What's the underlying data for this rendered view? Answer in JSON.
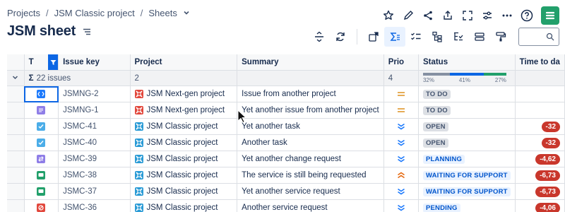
{
  "breadcrumb": {
    "items": [
      "Projects",
      "JSM Classic project",
      "Sheets"
    ]
  },
  "page": {
    "title": "JSM sheet"
  },
  "top_icons": [
    "star-icon",
    "edit-icon",
    "share-icon",
    "export-icon",
    "fullscreen-icon",
    "settings-sliders-icon",
    "more-icon",
    "help-icon",
    "app-logo"
  ],
  "toolbar": {
    "icons": [
      "row-height-icon",
      "refresh-icon",
      "add-view-icon",
      "sum-icon",
      "checklist-icon",
      "hierarchy-icon",
      "filter-tree-icon",
      "group-icon",
      "format-paint-icon"
    ],
    "search_placeholder": ""
  },
  "columns": [
    "T",
    "Issue key",
    "Project",
    "Summary",
    "Prio",
    "Status",
    "Time to da"
  ],
  "summary_row": {
    "issue_count": "22 issues",
    "project_count": "2",
    "prio_count": "4",
    "status_breakdown": [
      {
        "label": "32%",
        "color": "#8590a2",
        "fraction": 0.32
      },
      {
        "label": "41%",
        "color": "#0c66e4",
        "fraction": 0.41
      },
      {
        "label": "27%",
        "color": "#22a06b",
        "fraction": 0.27
      }
    ]
  },
  "rows": [
    {
      "type_color": "#1d7afc",
      "type_icon": "code-icon",
      "key": "JSMNG-2",
      "project": "JSM Next-gen project",
      "project_av": "#e2483d",
      "summary": "Issue from another project",
      "prio": "medium",
      "status": "TO DO",
      "status_class": "st-todo",
      "ttd": ""
    },
    {
      "type_color": "#8f7ee7",
      "type_icon": "list-icon",
      "key": "JSMNG-1",
      "project": "JSM Next-gen project",
      "project_av": "#e2483d",
      "summary": "Yet another issue from another project",
      "prio": "medium",
      "status": "TO DO",
      "status_class": "st-todo",
      "ttd": ""
    },
    {
      "type_color": "#4bade8",
      "type_icon": "check-icon",
      "key": "JSMC-41",
      "project": "JSM Classic project",
      "project_av": "#2a9bd6",
      "summary": "Yet another task",
      "prio": "low",
      "status": "OPEN",
      "status_class": "st-open",
      "ttd": "-32"
    },
    {
      "type_color": "#4bade8",
      "type_icon": "check-icon",
      "key": "JSMC-40",
      "project": "JSM Classic project",
      "project_av": "#2a9bd6",
      "summary": "Another task",
      "prio": "low",
      "status": "OPEN",
      "status_class": "st-open",
      "ttd": "-32"
    },
    {
      "type_color": "#8f7ee7",
      "type_icon": "change-icon",
      "key": "JSMC-39",
      "project": "JSM Classic project",
      "project_av": "#2a9bd6",
      "summary": "Yet another change request",
      "prio": "low",
      "status": "PLANNING",
      "status_class": "st-blue",
      "ttd": "-4,62"
    },
    {
      "type_color": "#22a06b",
      "type_icon": "chat-icon",
      "key": "JSMC-38",
      "project": "JSM Classic project",
      "project_av": "#2a9bd6",
      "summary": "The service is still being requested",
      "prio": "high",
      "status": "WAITING FOR SUPPORT",
      "status_class": "st-blue",
      "ttd": "-6,73"
    },
    {
      "type_color": "#22a06b",
      "type_icon": "chat-icon",
      "key": "JSMC-37",
      "project": "JSM Classic project",
      "project_av": "#2a9bd6",
      "summary": "Yet another service request",
      "prio": "low",
      "status": "WAITING FOR SUPPORT",
      "status_class": "st-blue",
      "ttd": "-6,73"
    },
    {
      "type_color": "#e2483d",
      "type_icon": "block-icon",
      "key": "JSMC-36",
      "project": "JSM Classic project",
      "project_av": "#2a9bd6",
      "summary": "Another service request",
      "prio": "low",
      "status": "PENDING",
      "status_class": "st-blue",
      "ttd": "-4,06"
    }
  ]
}
